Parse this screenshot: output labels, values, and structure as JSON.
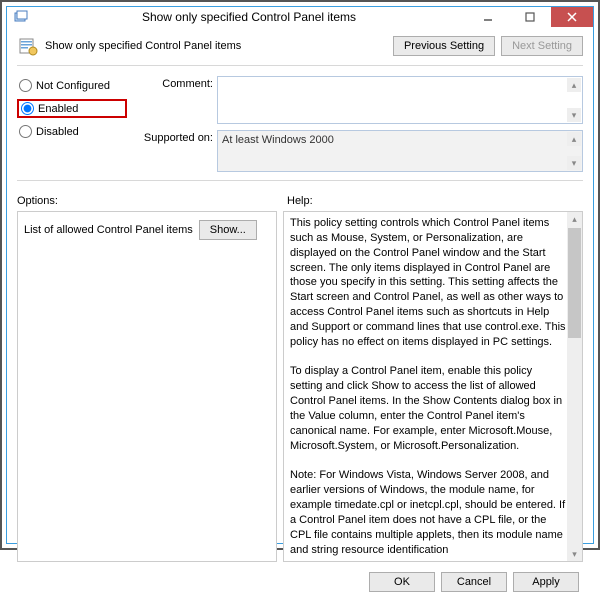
{
  "window": {
    "title": "Show only specified Control Panel items"
  },
  "header": {
    "policy_title": "Show only specified Control Panel items",
    "previous": "Previous Setting",
    "next": "Next Setting"
  },
  "state": {
    "not_configured": "Not Configured",
    "enabled": "Enabled",
    "disabled": "Disabled",
    "selected": "enabled"
  },
  "fields": {
    "comment_label": "Comment:",
    "comment_value": "",
    "supported_label": "Supported on:",
    "supported_value": "At least Windows 2000"
  },
  "labels": {
    "options": "Options:",
    "help": "Help:"
  },
  "options": {
    "list_label": "List of allowed Control Panel items",
    "show": "Show..."
  },
  "help": {
    "p1": "This policy setting controls which Control Panel items such as Mouse, System, or Personalization, are displayed on the Control Panel window and the Start screen. The only items displayed in Control Panel are those you specify in this setting. This setting affects the Start screen and Control Panel, as well as other ways to access Control Panel items such as shortcuts in Help and Support or command lines that use control.exe. This policy has no effect on items displayed in PC settings.",
    "p2": "To display a Control Panel item, enable this policy setting and click Show to access the list of allowed Control Panel items. In the Show Contents dialog box in the Value column, enter the Control Panel item's canonical name. For example, enter Microsoft.Mouse, Microsoft.System, or Microsoft.Personalization.",
    "p3": "Note: For Windows Vista, Windows Server 2008, and earlier versions of Windows, the module name, for example timedate.cpl or inetcpl.cpl, should be entered. If a Control Panel item does not have a CPL file, or the CPL file contains multiple applets, then its module name and string resource identification"
  },
  "footer": {
    "ok": "OK",
    "cancel": "Cancel",
    "apply": "Apply"
  }
}
